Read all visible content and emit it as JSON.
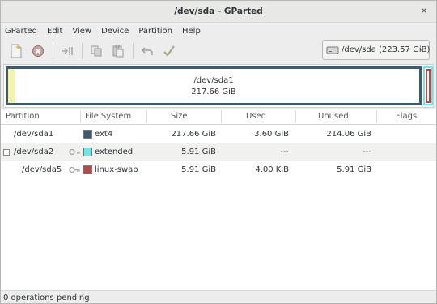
{
  "window": {
    "title": "/dev/sda - GParted",
    "close_glyph": "✕"
  },
  "menubar": {
    "items": [
      "GParted",
      "Edit",
      "View",
      "Device",
      "Partition",
      "Help"
    ]
  },
  "toolbar": {
    "icons": [
      "new-icon",
      "delete-icon",
      "resize-move-icon",
      "copy-icon",
      "paste-icon",
      "undo-icon",
      "apply-icon"
    ]
  },
  "device_selector": {
    "label": "/dev/sda  (223.57 GiB)",
    "chevron": "⌄"
  },
  "disk_graphic": {
    "main_partition_name": "/dev/sda1",
    "main_partition_size": "217.66 GiB",
    "sda1_used_fraction": 0.0165,
    "colors": {
      "ext4": "#41596d",
      "extended": "#6ce6ea",
      "linux_swap": "#b34a4a",
      "used_fill": "#f5f3a9"
    }
  },
  "table": {
    "headers": {
      "partition": "Partition",
      "file_system": "File System",
      "size": "Size",
      "used": "Used",
      "unused": "Unused",
      "flags": "Flags"
    },
    "rows": [
      {
        "partition": "/dev/sda1",
        "file_system": "ext4",
        "fs_color": "#41596d",
        "size": "217.66 GiB",
        "used": "3.60 GiB",
        "unused": "214.06 GiB",
        "flags": "",
        "has_key": false
      },
      {
        "partition": "/dev/sda2",
        "file_system": "extended",
        "fs_color": "#6ce6ea",
        "size": "5.91 GiB",
        "used": "---",
        "unused": "---",
        "flags": "",
        "has_key": true,
        "expander": "−"
      },
      {
        "partition": "/dev/sda5",
        "file_system": "linux-swap",
        "fs_color": "#b34a4a",
        "size": "5.91 GiB",
        "used": "4.00 KiB",
        "unused": "5.91 GiB",
        "flags": "",
        "has_key": true
      }
    ]
  },
  "status": {
    "text": "0 operations pending"
  }
}
